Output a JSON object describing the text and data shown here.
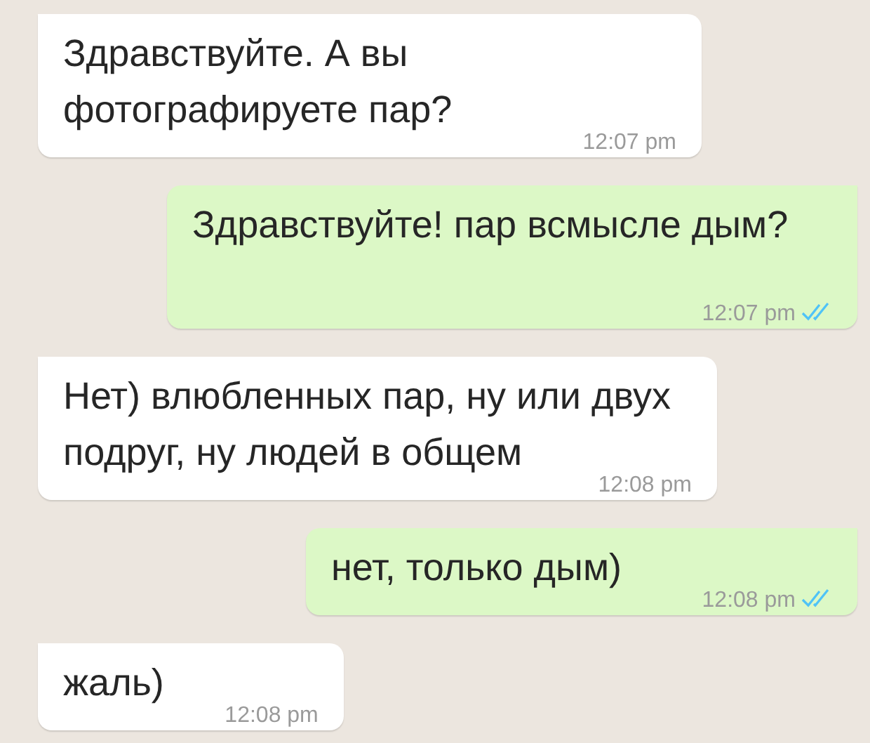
{
  "messages": [
    {
      "kind": "incoming",
      "text": "Здравствуйте. А вы фотографируете пар?",
      "time": "12:07 pm"
    },
    {
      "kind": "outgoing",
      "text": "Здравствуйте! пар всмысле дым?",
      "time": "12:07 pm",
      "read": true
    },
    {
      "kind": "incoming",
      "text": "Нет) влюбленных пар, ну или двух подруг, ну людей в общем",
      "time": "12:08 pm"
    },
    {
      "kind": "outgoing",
      "text": "нет, только дым)",
      "time": "12:08 pm",
      "read": true
    },
    {
      "kind": "incoming",
      "text": "жаль)",
      "time": "12:08 pm"
    }
  ]
}
